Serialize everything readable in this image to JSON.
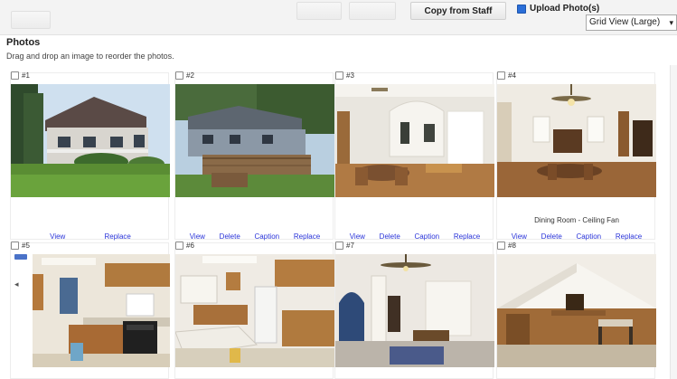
{
  "toolbar": {
    "left_button": "",
    "faint_button_1": "",
    "faint_button_2": "",
    "copy_button": "Copy from Staff",
    "upload_label": "Upload Photo(s)"
  },
  "view_select": {
    "value": "Grid View (Large)"
  },
  "header": {
    "title": "Photos",
    "hint": "Drag and drop an image to reorder the photos."
  },
  "photos": [
    {
      "num": "#1",
      "caption": "",
      "actions": [
        "View",
        "Replace"
      ]
    },
    {
      "num": "#2",
      "caption": "",
      "actions": [
        "View",
        "Delete",
        "Caption",
        "Replace"
      ]
    },
    {
      "num": "#3",
      "caption": "",
      "actions": [
        "View",
        "Delete",
        "Caption",
        "Replace"
      ]
    },
    {
      "num": "#4",
      "caption": "Dining Room - Ceiling Fan",
      "actions": [
        "View",
        "Delete",
        "Caption",
        "Replace"
      ]
    },
    {
      "num": "#5",
      "caption": "",
      "actions": []
    },
    {
      "num": "#6",
      "caption": "",
      "actions": []
    },
    {
      "num": "#7",
      "caption": "",
      "actions": []
    },
    {
      "num": "#8",
      "caption": "",
      "actions": []
    }
  ]
}
